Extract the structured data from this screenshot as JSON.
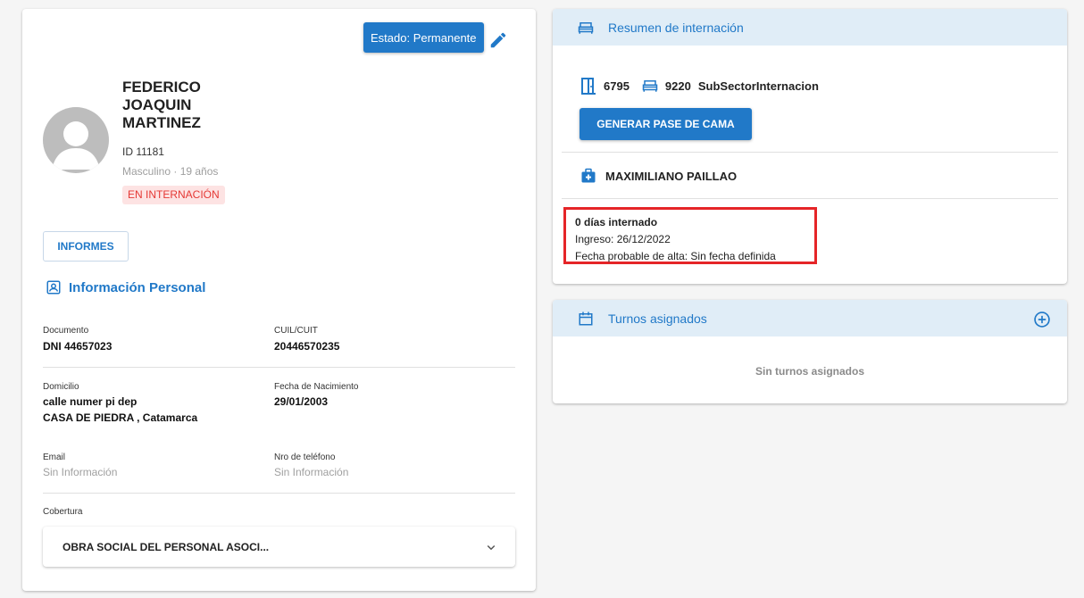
{
  "patient": {
    "estado_label": "Estado: Permanente",
    "name": "FEDERICO JOAQUIN MARTINEZ",
    "id_label": "ID 11181",
    "gender_age": "Masculino · 19 años",
    "status_badge": "EN INTERNACIÓN",
    "informes_label": "INFORMES"
  },
  "personal_info": {
    "title": "Información Personal",
    "documento_label": "Documento",
    "documento_value": "DNI 44657023",
    "cuil_label": "CUIL/CUIT",
    "cuil_value": "20446570235",
    "domicilio_label": "Domicilio",
    "domicilio_line1": "calle numer pi dep",
    "domicilio_line2": "CASA DE PIEDRA , Catamarca",
    "fecha_nac_label": "Fecha de Nacimiento",
    "fecha_nac_value": "29/01/2003",
    "email_label": "Email",
    "email_value": "Sin Información",
    "telefono_label": "Nro de teléfono",
    "telefono_value": "Sin Información",
    "cobertura_label": "Cobertura",
    "cobertura_value": "OBRA SOCIAL DEL PERSONAL ASOCI..."
  },
  "summary": {
    "title": "Resumen de internación",
    "room": "6795",
    "bed": "9220",
    "sector": "SubSectorInternacion",
    "pase_button": "GENERAR PASE DE CAMA",
    "doctor": "MAXIMILIANO PAILLAO",
    "days": "0 días internado",
    "ingreso": "Ingreso: 26/12/2022",
    "alta": "Fecha probable de alta: Sin fecha definida"
  },
  "turnos": {
    "title": "Turnos asignados",
    "empty": "Sin turnos asignados"
  },
  "colors": {
    "primary": "#2179c8",
    "header_bg": "#e0edf7",
    "badge_bg": "#fde3e3",
    "badge_text": "#e53935",
    "highlight_border": "#e52528"
  }
}
